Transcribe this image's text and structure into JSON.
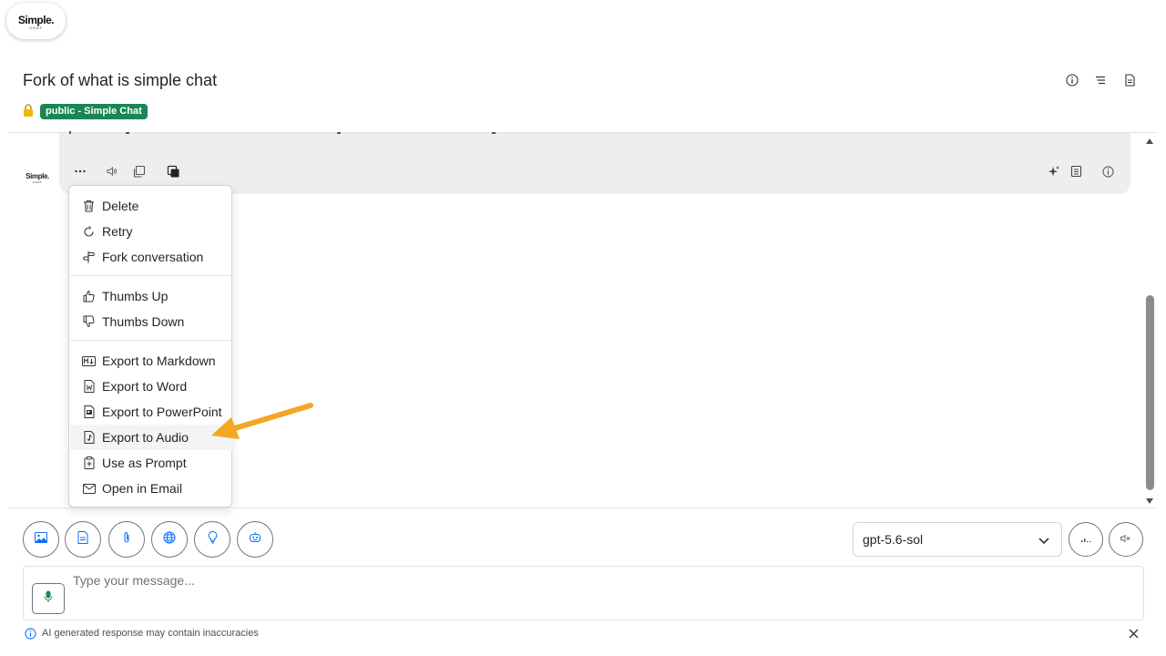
{
  "logo": {
    "line1": "Simple.",
    "line2": "CHAT"
  },
  "conversation": {
    "title": "Fork of what is simple chat",
    "badge": "public - Simple Chat"
  },
  "header_icons": [
    "info-circle-icon",
    "list-icon",
    "document-icon"
  ],
  "message": {
    "avatar_line1": "Simple.",
    "avatar_line2": "CHAT",
    "actions_left": [
      "more-dots-icon",
      "speaker-icon",
      "copy-icon",
      "copy-filled-icon"
    ],
    "actions_right": [
      "sparkle-icon",
      "notebook-icon",
      "info-circle-icon"
    ]
  },
  "menu": {
    "groups": [
      [
        {
          "label": "Delete",
          "icon": "trash-icon"
        },
        {
          "label": "Retry",
          "icon": "retry-icon"
        },
        {
          "label": "Fork conversation",
          "icon": "signpost-icon"
        }
      ],
      [
        {
          "label": "Thumbs Up",
          "icon": "thumbs-up-icon"
        },
        {
          "label": "Thumbs Down",
          "icon": "thumbs-down-icon"
        }
      ],
      [
        {
          "label": "Export to Markdown",
          "icon": "markdown-icon"
        },
        {
          "label": "Export to Word",
          "icon": "word-file-icon"
        },
        {
          "label": "Export to PowerPoint",
          "icon": "powerpoint-file-icon"
        },
        {
          "label": "Export to Audio",
          "icon": "audio-file-icon",
          "highlighted": true
        },
        {
          "label": "Use as Prompt",
          "icon": "clipboard-plus-icon"
        },
        {
          "label": "Open in Email",
          "icon": "envelope-icon"
        }
      ]
    ]
  },
  "toolbar": {
    "tools": [
      "image-icon",
      "document-icon",
      "paperclip-icon",
      "globe-icon",
      "lightbulb-icon",
      "robot-icon"
    ],
    "model": "gpt-5.6-sol",
    "right_tools": [
      "voice-wave-icon",
      "speaker-muted-icon"
    ]
  },
  "input": {
    "placeholder": "Type your message..."
  },
  "footer": {
    "disclaimer": "AI generated response may contain inaccuracies"
  },
  "colors": {
    "badge": "#198754",
    "arrow": "#F5A623",
    "bubble": "#EEEEEE",
    "mic": "#198754"
  }
}
